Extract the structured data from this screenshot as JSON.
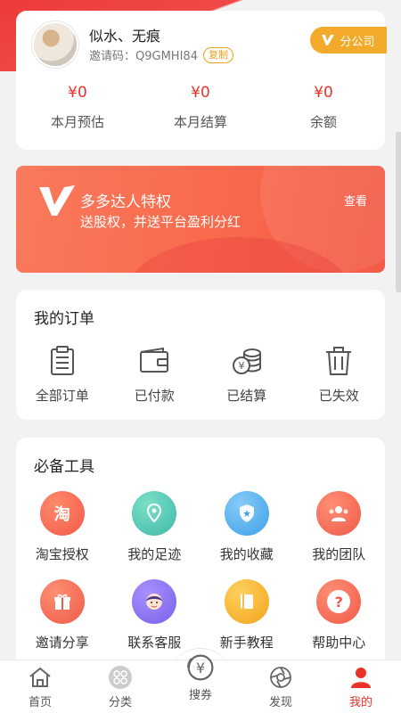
{
  "profile": {
    "username": "似水、无痕",
    "invite_label": "邀请码：",
    "invite_code": "Q9GMHI84",
    "copy_label": "复制",
    "branch_label": "分公司"
  },
  "stats": [
    {
      "value": "¥0",
      "label": "本月预估"
    },
    {
      "value": "¥0",
      "label": "本月结算"
    },
    {
      "value": "¥0",
      "label": "余额"
    }
  ],
  "banner": {
    "title": "多多达人特权",
    "subtitle": "送股权，并送平台盈利分红",
    "view_label": "查看"
  },
  "orders": {
    "title": "我的订单",
    "items": [
      {
        "label": "全部订单",
        "icon": "clipboard-icon"
      },
      {
        "label": "已付款",
        "icon": "wallet-icon"
      },
      {
        "label": "已结算",
        "icon": "coins-icon"
      },
      {
        "label": "已失效",
        "icon": "trash-icon"
      }
    ]
  },
  "tools": {
    "title": "必备工具",
    "items": [
      {
        "label": "淘宝授权",
        "icon": "taobao-icon",
        "glyph": "淘",
        "color": "#f25a4a"
      },
      {
        "label": "我的足迹",
        "icon": "location-icon",
        "glyph": "",
        "color": "#4bc7b2"
      },
      {
        "label": "我的收藏",
        "icon": "shield-star-icon",
        "glyph": "",
        "color": "#4aa8ec"
      },
      {
        "label": "我的团队",
        "icon": "team-icon",
        "glyph": "",
        "color": "#f2664e"
      },
      {
        "label": "邀请分享",
        "icon": "gift-icon",
        "glyph": "",
        "color": "#f2664e"
      },
      {
        "label": "联系客服",
        "icon": "service-icon",
        "glyph": "",
        "color": "#8a6ff0"
      },
      {
        "label": "新手教程",
        "icon": "book-icon",
        "glyph": "",
        "color": "#f5b020"
      },
      {
        "label": "帮助中心",
        "icon": "help-icon",
        "glyph": "?",
        "color": "#f2664e"
      }
    ]
  },
  "nav": [
    {
      "label": "首页",
      "icon": "home-icon"
    },
    {
      "label": "分类",
      "icon": "category-icon"
    },
    {
      "label": "搜券",
      "icon": "coupon-icon"
    },
    {
      "label": "发现",
      "icon": "discover-icon"
    },
    {
      "label": "我的",
      "icon": "profile-icon"
    }
  ],
  "colors": {
    "accent": "#e8332b",
    "branch": "#f3a92a",
    "banner": "#f9694c"
  }
}
